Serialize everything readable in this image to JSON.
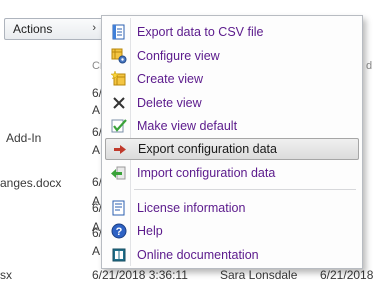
{
  "actions_button": {
    "label": "Actions",
    "chevron": "›"
  },
  "background": {
    "col_header_left": "Cr",
    "col_header_right": "d",
    "rows": [
      {
        "name": "",
        "date": "6/",
        "time": "AM"
      },
      {
        "name": "Add-In",
        "date": "6/",
        "time": "AM"
      },
      {
        "name": "anges.docx",
        "date": "6/",
        "time": "AM"
      },
      {
        "name": "",
        "date": "6/",
        "time": "AM"
      },
      {
        "name": "",
        "date": "6/",
        "time": "AM"
      }
    ],
    "last_row": {
      "name": "sx",
      "created": "6/21/2018 3:36:11",
      "author": "Sara Lonsdale",
      "modified": "6/21/2018"
    }
  },
  "menu": {
    "items": [
      {
        "label": "Export data to CSV file",
        "icon": "csv-file-icon"
      },
      {
        "label": "Configure view",
        "icon": "configure-view-icon"
      },
      {
        "label": "Create view",
        "icon": "create-view-icon"
      },
      {
        "label": "Delete view",
        "icon": "delete-x-icon"
      },
      {
        "label": "Make view default",
        "icon": "checkmark-icon"
      },
      {
        "label": "Export configuration data",
        "icon": "export-arrow-icon"
      },
      {
        "label": "Import configuration data",
        "icon": "import-arrow-icon"
      },
      {
        "label": "License information",
        "icon": "license-icon"
      },
      {
        "label": "Help",
        "icon": "help-icon"
      },
      {
        "label": "Online documentation",
        "icon": "book-icon"
      }
    ],
    "highlighted_index": 5
  },
  "colors": {
    "menu_text": "#5b1a8c",
    "highlight": "#dcdcdc"
  }
}
